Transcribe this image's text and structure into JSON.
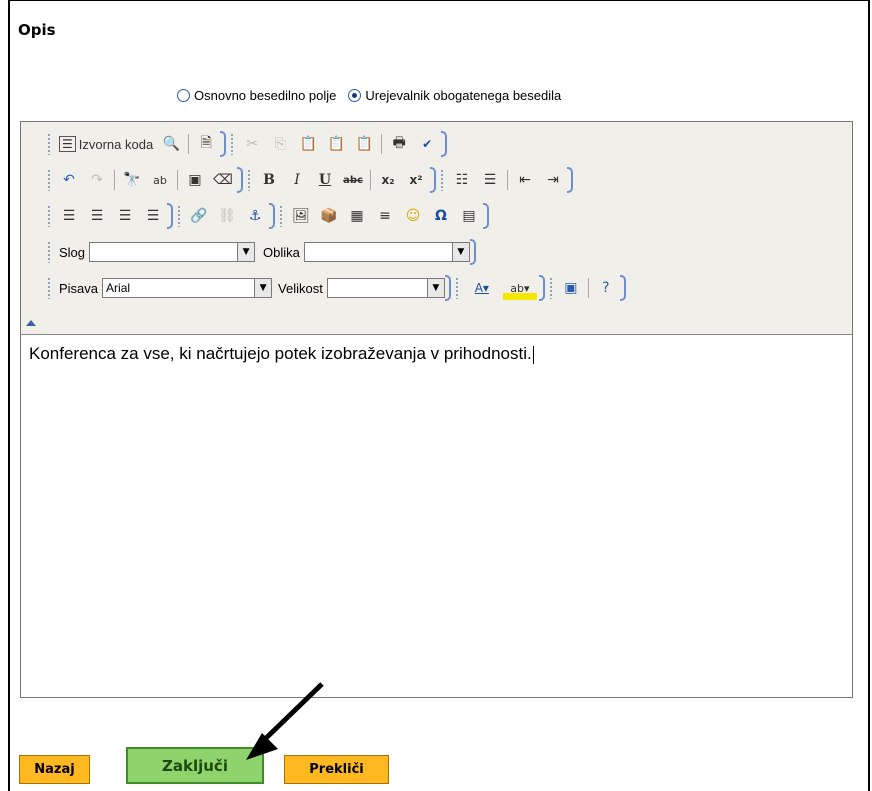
{
  "section": {
    "title": "Opis"
  },
  "mode": {
    "options": [
      {
        "label": "Osnovno besedilno polje",
        "selected": false
      },
      {
        "label": "Urejevalnik obogatenega besedila",
        "selected": true
      }
    ]
  },
  "toolbar": {
    "source_label": "Izvorna koda",
    "style_label": "Slog",
    "style_value": "",
    "format_label": "Oblika",
    "format_value": "",
    "font_label": "Pisava",
    "font_value": "Arial",
    "size_label": "Velikost",
    "size_value": "",
    "bold": "B",
    "italic": "I",
    "underline": "U",
    "strike": "abc",
    "subscript": "x₂",
    "superscript": "x²",
    "omega": "Ω"
  },
  "editor": {
    "content": "Konferenca za vse, ki načrtujejo potek izobraževanja v prihodnosti."
  },
  "buttons": {
    "back": "Nazaj",
    "finish": "Zaključi",
    "cancel": "Prekliči"
  },
  "colors": {
    "orange_button": "#ffb81f",
    "green_button": "#8ed36b",
    "group_border": "#6e8fcf"
  }
}
